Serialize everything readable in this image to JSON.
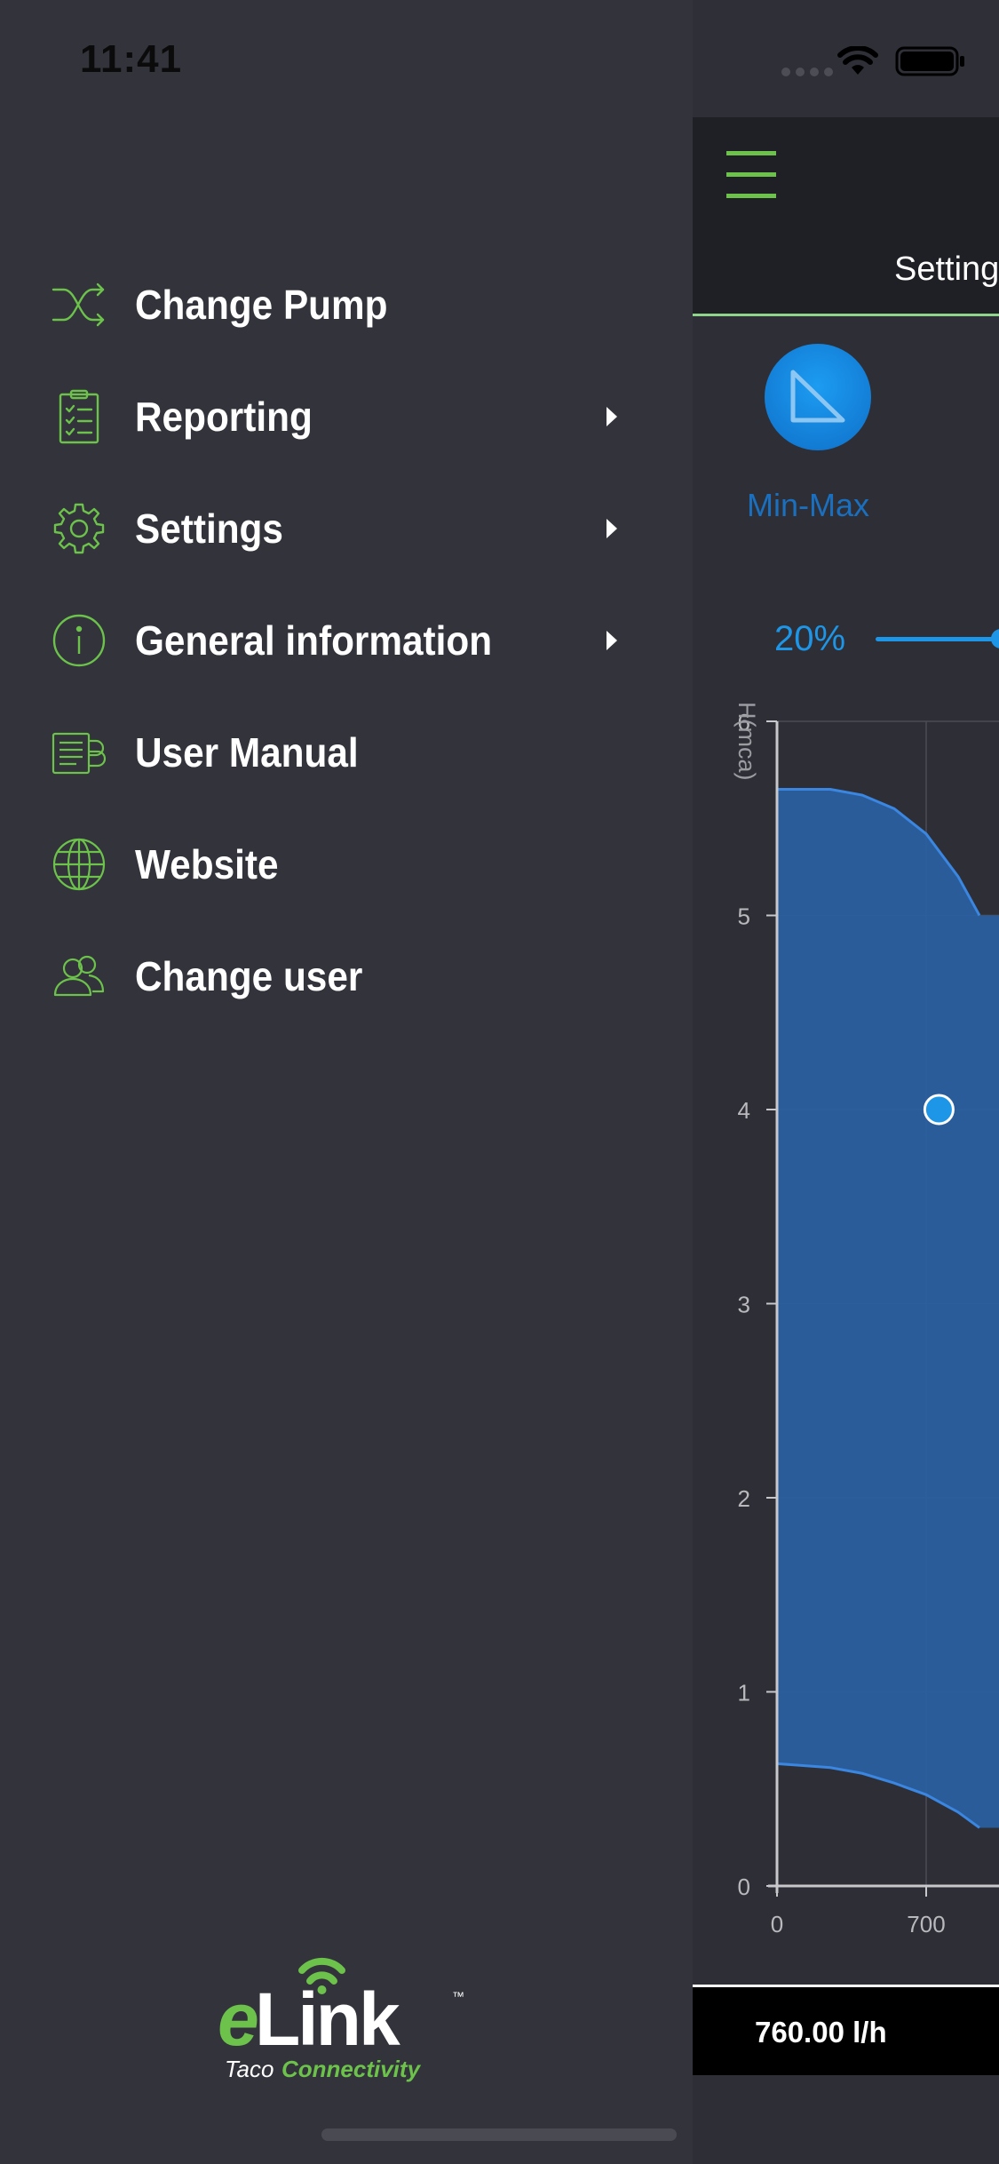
{
  "status": {
    "time": "11:41"
  },
  "drawer": {
    "menu": [
      {
        "label": "Change Pump",
        "icon": "shuffle-icon",
        "has_submenu": false
      },
      {
        "label": "Reporting",
        "icon": "clipboard-checklist-icon",
        "has_submenu": true
      },
      {
        "label": "Settings",
        "icon": "gear-icon",
        "has_submenu": true
      },
      {
        "label": "General information",
        "icon": "info-icon",
        "has_submenu": true
      },
      {
        "label": "User Manual",
        "icon": "manual-icon",
        "has_submenu": false
      },
      {
        "label": "Website",
        "icon": "globe-icon",
        "has_submenu": false
      },
      {
        "label": "Change user",
        "icon": "users-icon",
        "has_submenu": false
      }
    ],
    "logo": {
      "brand": "eLink",
      "tagline_prefix": "Taco",
      "tagline": "Connectivity",
      "tm": "™"
    }
  },
  "main": {
    "tab_label": "Setting",
    "mode_label": "Min-Max",
    "percent_label": "20%",
    "flow_value": "760.00 l/h"
  },
  "colors": {
    "accent_green": "#6cc24a",
    "chart_blue": "#2a5fa0",
    "highlight_blue": "#1e96e8"
  },
  "chart_data": {
    "type": "area",
    "ylabel": "H(mca)",
    "y_ticks": [
      "0",
      "1",
      "2",
      "3",
      "4",
      "5",
      "6"
    ],
    "x_ticks": [
      "0",
      "700"
    ],
    "ylim": [
      0,
      6
    ],
    "xlim": [
      0,
      1140
    ],
    "grid": true,
    "upper_curve": {
      "x": [
        0,
        250,
        400,
        550,
        700,
        850,
        950
      ],
      "y": [
        5.65,
        5.65,
        5.62,
        5.55,
        5.42,
        5.2,
        5.0
      ]
    },
    "lower_curve": {
      "x": [
        0,
        250,
        400,
        550,
        700,
        850,
        950
      ],
      "y": [
        0.63,
        0.61,
        0.58,
        0.53,
        0.47,
        0.38,
        0.3
      ]
    },
    "operating_point": {
      "x": 760,
      "y": 4.0
    }
  }
}
